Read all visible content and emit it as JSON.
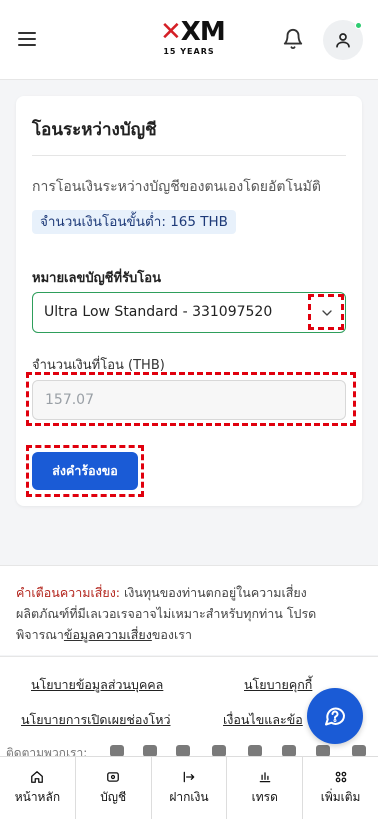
{
  "header": {
    "logo_text": "XM",
    "logo_sub": "15 YEARS",
    "colors": {
      "logo_accent": "#d51f26"
    }
  },
  "transfer": {
    "title": "โอนระหว่างบัญชี",
    "description": "การโอนเงินระหว่างบัญชีของตนเองโดยอัตโนมัติ",
    "min_amount": "จำนวนเงินโอนขั้นต่ำ: 165 THB",
    "account_label": "หมายเลขบัญชีที่รับโอน",
    "account_value": "Ultra Low Standard - 331097520",
    "amount_label": "จำนวนเงินที่โอน (THB)",
    "amount_placeholder": "157.07",
    "submit_label": "ส่งคำร้องขอ",
    "colors": {
      "primary": "#1a5bd6",
      "select_border": "#2e9e5b",
      "highlight": "#e0000d"
    }
  },
  "risk": {
    "warning_label": "คำเตือนความเสี่ยง:",
    "text_1": " เงินทุนของท่านตกอยู่ในความเสี่ยง ผลิตภัณฑ์ที่มีเลเวอเรจอาจไม่เหมาะสำหรับทุกท่าน โปรดพิจารณา",
    "link": "ข้อมูลความเสี่ยง",
    "text_2": "ของเรา"
  },
  "footer_links": {
    "privacy": "นโยบายข้อมูลส่วนบุคคล",
    "cookies": "นโยบายคุกกี้",
    "disclosure": "นโยบายการเปิดเผยช่องโหว่",
    "terms": "เงื่อนไขและข้อ",
    "follow_us": "ติดตามพวกเรา:"
  },
  "social_icons": [
    "facebook-icon",
    "x-icon",
    "youtube-icon",
    "instagram-icon",
    "linkedin-icon",
    "tiktok-icon",
    "messenger-icon",
    "threads-icon"
  ],
  "tabs": [
    {
      "label": "หน้าหลัก",
      "icon": "home-icon"
    },
    {
      "label": "บัญชี",
      "icon": "account-icon"
    },
    {
      "label": "ฝากเงิน",
      "icon": "deposit-icon"
    },
    {
      "label": "เทรด",
      "icon": "trade-icon"
    },
    {
      "label": "เพิ่มเติม",
      "icon": "more-icon"
    }
  ]
}
